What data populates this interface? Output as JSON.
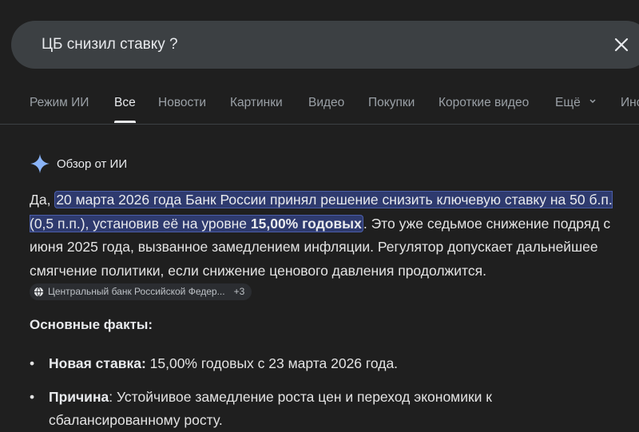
{
  "search": {
    "query": "ЦБ снизил ставку ?"
  },
  "tabs": [
    {
      "label": "Режим ИИ"
    },
    {
      "label": "Все"
    },
    {
      "label": "Новости"
    },
    {
      "label": "Картинки"
    },
    {
      "label": "Видео"
    },
    {
      "label": "Покупки"
    },
    {
      "label": "Короткие видео"
    },
    {
      "label": "Ещё"
    },
    {
      "label": "Инс"
    }
  ],
  "active_tab": "Все",
  "ai_overview": {
    "title": "Обзор от ИИ",
    "intro": "Да, ",
    "highlight": "20 марта 2026 года Банк России принял решение снизить ключевую ставку на 50 б.п. (0,5 п.п.), установив её на уровне ",
    "highlight_bold": "15,00% годовых",
    "rest": ". Это уже седьмое снижение подряд с июня 2025 года, вызванное замедлением инфляции. Регулятор допускает дальнейшее смягчение политики, если снижение ценового давления продолжится.",
    "source_label": "Центральный банк Российской Федер...",
    "source_more": "+3"
  },
  "facts": {
    "title": "Основные факты:",
    "items": [
      {
        "key": "Новая ставка:",
        "text": " 15,00% годовых с 23 марта 2026 года."
      },
      {
        "key": "Причина",
        "text": ": Устойчивое замедление роста цен и переход экономики к сбалансированному росту."
      }
    ]
  },
  "colors": {
    "background": "#1f1f1f",
    "search_bg": "#3c4043",
    "highlight_bg": "#2e3a6e",
    "sparkle": "#8ab4f8"
  }
}
